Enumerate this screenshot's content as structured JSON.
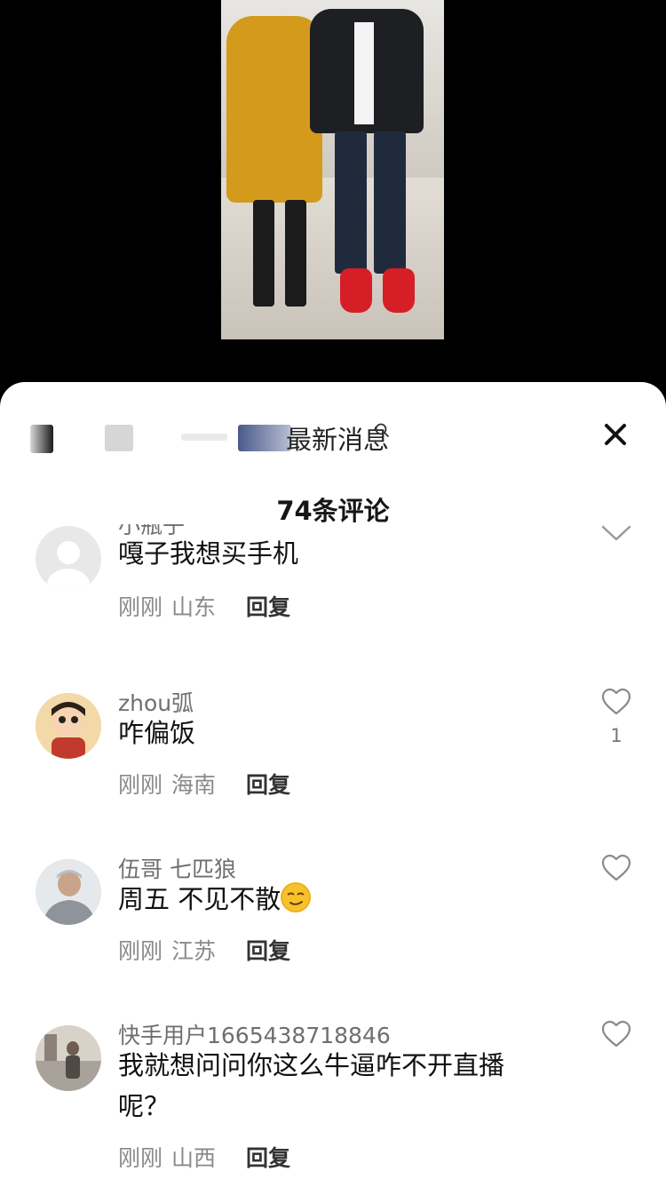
{
  "header": {
    "blurred_text_fragment": "最新消息",
    "comment_count_title": "74条评论"
  },
  "comments": [
    {
      "username": "小瓶子",
      "text": "嘎子我想买手机",
      "time": "刚刚",
      "region": "山东",
      "reply": "回复",
      "likes": ""
    },
    {
      "username": "zhou弧",
      "text": "咋偏饭",
      "time": "刚刚",
      "region": "海南",
      "reply": "回复",
      "likes": "1"
    },
    {
      "username": "伍哥 七匹狼",
      "text": "周五 不见不散",
      "time": "刚刚",
      "region": "江苏",
      "reply": "回复",
      "likes": ""
    },
    {
      "username": "快手用户1665438718846",
      "text": "我就想问问你这么牛逼咋不开直播呢？",
      "time": "刚刚",
      "region": "山西",
      "reply": "回复",
      "likes": ""
    }
  ],
  "icons": {
    "search": "search-icon",
    "close": "close-icon",
    "like": "heart-outline-icon",
    "collapse": "chevron-down-icon",
    "emoji": "smirk-emoji-icon"
  },
  "colors": {
    "sheet_bg": "#ffffff",
    "username": "#6f6f6f",
    "meta": "#8a8a8a",
    "text": "#111111"
  }
}
